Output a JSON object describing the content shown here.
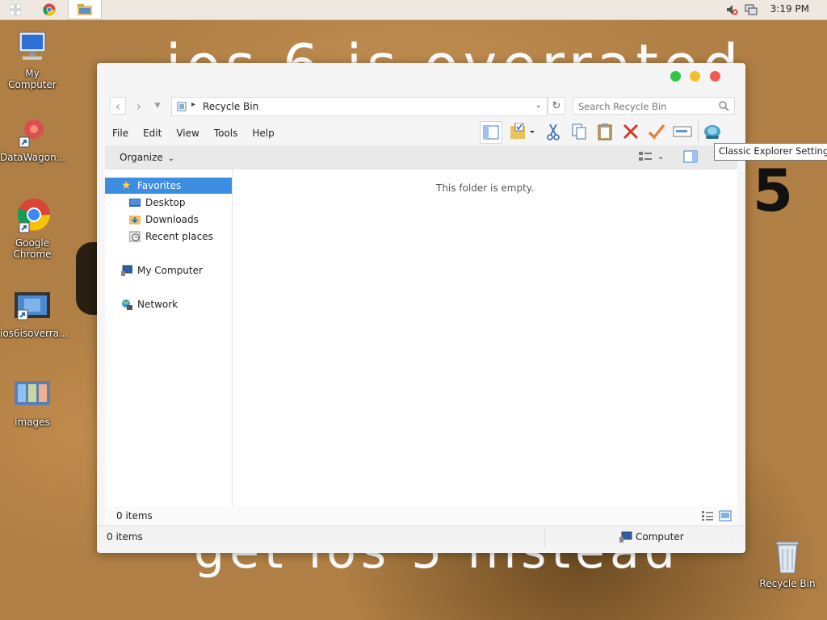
{
  "taskbar": {
    "clock": "3:19 PM"
  },
  "wallpaper": {
    "top_text": "ios 6 is overrated",
    "bottom_text": "get ios 5 instead",
    "big_number": "5"
  },
  "desktop_icons": [
    {
      "label": "My Computer"
    },
    {
      "label": "DataWagon..."
    },
    {
      "label": "Google Chrome"
    },
    {
      "label": "ios6isoverra..."
    },
    {
      "label": "images"
    },
    {
      "label": "Recycle Bin"
    }
  ],
  "window": {
    "address": {
      "location": "Recycle Bin"
    },
    "search": {
      "placeholder": "Search Recycle Bin"
    },
    "menu": [
      "File",
      "Edit",
      "View",
      "Tools",
      "Help"
    ],
    "organize_label": "Organize",
    "nav": {
      "favorites": "Favorites",
      "desktop": "Desktop",
      "downloads": "Downloads",
      "recent": "Recent places",
      "computer": "My Computer",
      "network": "Network"
    },
    "empty_message": "This folder is empty.",
    "details_count": "0 items",
    "status_count": "0 items",
    "status_location": "Computer"
  },
  "tooltip": "Classic Explorer Settings",
  "colors": {
    "selection": "#3d8de0",
    "close": "#ee5a52",
    "minimize": "#f6bd2b",
    "maximize": "#2fc840"
  }
}
